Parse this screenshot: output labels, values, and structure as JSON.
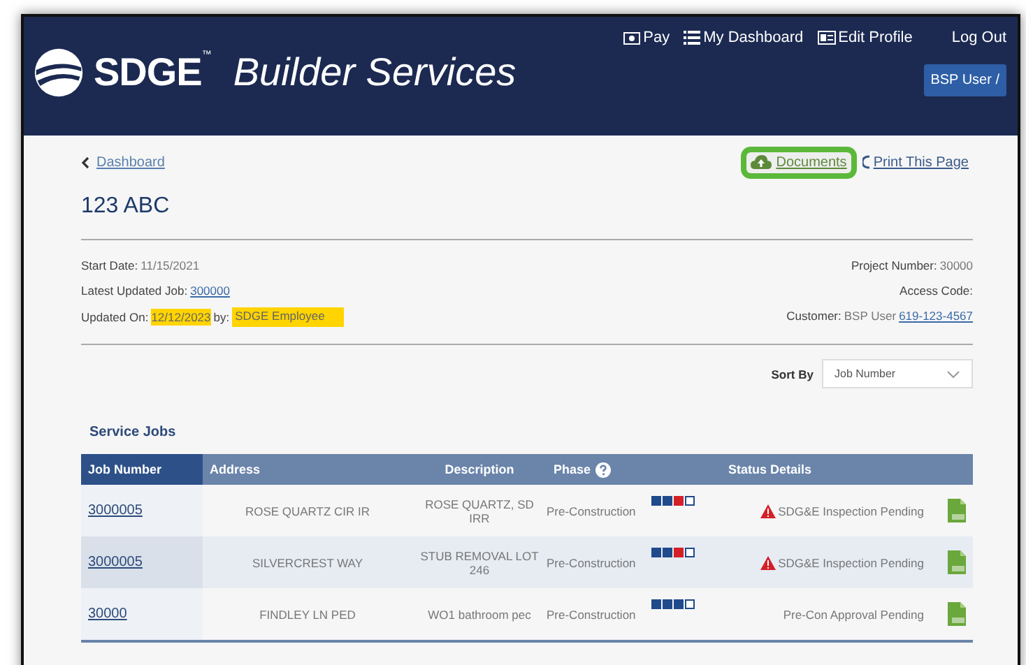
{
  "header": {
    "brand": "SDGE",
    "trademark": "™",
    "title": "Builder Services",
    "nav": [
      {
        "label": "Pay",
        "kind": "cash"
      },
      {
        "label": "My Dashboard",
        "kind": "list"
      },
      {
        "label": "Edit Profile",
        "kind": "card"
      },
      {
        "label": "Log Out",
        "kind": "plain"
      }
    ],
    "user_button": "BSP User /"
  },
  "back_link": "Dashboard",
  "actions": [
    {
      "label": "Documents",
      "kind": "cloud",
      "highlighted": true
    },
    {
      "label": "Print This Page",
      "kind": "print",
      "highlighted": false
    }
  ],
  "project_title": "123 ABC",
  "details_left": [
    {
      "label": "Start Date:",
      "value": "11/15/2021",
      "kind": "text"
    },
    {
      "label": "Latest Updated Job:",
      "value": "300000",
      "kind": "link"
    },
    {
      "label": "Updated On:",
      "value": "12/12/2023",
      "by_label": "by:",
      "by_value": "SDGE Employee",
      "kind": "highlight"
    }
  ],
  "details_right": [
    {
      "label": "Project Number:",
      "value": "30000"
    },
    {
      "label": "Access Code:"
    },
    {
      "label": "Customer:",
      "value": "BSP User",
      "link": "619-123-4567"
    }
  ],
  "sort": {
    "label": "Sort By",
    "value": "Job Number"
  },
  "section_title": "Service Jobs",
  "table": {
    "columns": [
      "Job Number",
      "Address",
      "Description",
      "Phase",
      "Status Details"
    ],
    "rows": [
      {
        "job": "3000005",
        "address": "ROSE QUARTZ CIR IR",
        "description": "ROSE QUARTZ, SD IRR",
        "phase": "Pre-Construction",
        "steps": [
          {
            "kind": "done"
          },
          {
            "kind": "done"
          },
          {
            "kind": "alert"
          },
          {
            "kind": "todo"
          }
        ],
        "warning": true,
        "status": "SDG&E Inspection Pending"
      },
      {
        "job": "3000005",
        "address": "SILVERCREST WAY",
        "description": "STUB REMOVAL LOT 246",
        "phase": "Pre-Construction",
        "steps": [
          {
            "kind": "done"
          },
          {
            "kind": "done"
          },
          {
            "kind": "alert"
          },
          {
            "kind": "todo"
          }
        ],
        "warning": true,
        "status": "SDG&E Inspection Pending"
      },
      {
        "job": "30000",
        "address": "FINDLEY LN PED",
        "description": "WO1 bathroom pec",
        "phase": "Pre-Construction",
        "steps": [
          {
            "kind": "done"
          },
          {
            "kind": "done"
          },
          {
            "kind": "done"
          },
          {
            "kind": "todo"
          }
        ],
        "warning": false,
        "status": "Pre-Con Approval Pending"
      }
    ]
  }
}
